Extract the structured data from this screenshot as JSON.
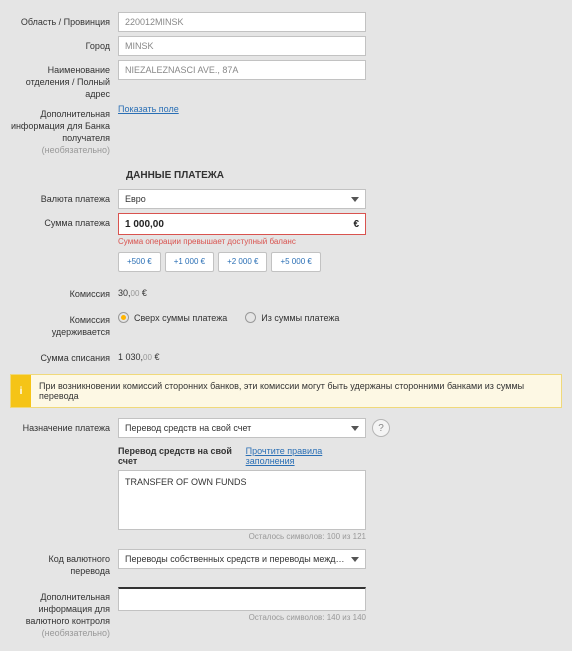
{
  "recipient": {
    "region_label": "Область / Провинция",
    "region_value": "220012MINSK",
    "city_label": "Город",
    "city_value": "MINSK",
    "branch_label": "Наименование отделения / Полный адрес",
    "branch_value": "NIEZALEZNASCI AVE., 87A",
    "extra_label": "Дополнительная информация для Банка получателя",
    "extra_sub": "(необязательно)",
    "show_field_link": "Показать поле"
  },
  "payment": {
    "section_title": "ДАННЫЕ ПЛАТЕЖА",
    "currency_label": "Валюта платежа",
    "currency_value": "Евро",
    "amount_label": "Сумма платежа",
    "amount_value": "1 000,00",
    "amount_currency": "€",
    "amount_error": "Сумма операции превышает доступный баланс",
    "chips": [
      "+500 €",
      "+1 000 €",
      "+2 000 €",
      "+5 000 €"
    ],
    "fee_label": "Комиссия",
    "fee_value": "30,",
    "fee_cents": "00",
    "fee_cur": " €",
    "fee_taken_label": "Комиссия удерживается",
    "fee_opt_over": "Сверх суммы платежа",
    "fee_opt_from": "Из суммы платежа",
    "debit_label": "Сумма списания",
    "debit_value": "1 030,",
    "debit_cents": "00",
    "debit_cur": " €"
  },
  "info_banner": "При возникновении комиссий сторонних банков, эти комиссии могут быть удержаны сторонними банками из суммы перевода",
  "purpose": {
    "label": "Назначение платежа",
    "select_value": "Перевод средств на свой счет",
    "line_title": "Перевод средств на свой счет",
    "rules_link": "Прочтите правила заполнения",
    "ta_value": "TRANSFER OF OWN FUNDS",
    "counter": "Осталось символов: 100 из 121"
  },
  "code": {
    "label": "Код валютного перевода",
    "select_value": "Переводы собственных средств и переводы между близкими родственник..."
  },
  "ccontrol": {
    "label": "Дополнительная информация для валютного контроля",
    "sub": "(необязательно)",
    "counter": "Осталось символов: 140 из 140"
  }
}
